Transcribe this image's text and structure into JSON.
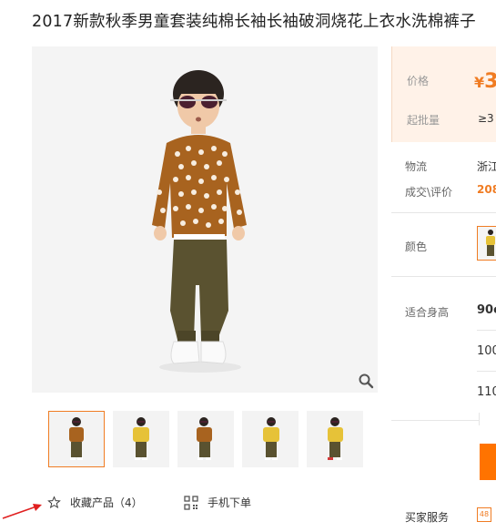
{
  "product": {
    "title": "2017新款秋季男童套装纯棉长袖长袖破洞烧花上衣水洗棉裤子"
  },
  "gallery": {
    "thumbnail_count": 5,
    "active_index": 0
  },
  "actions": {
    "favorite_label": "收藏产品（4）",
    "mobile_order_label": "手机下单"
  },
  "pricing": {
    "price_label": "价格",
    "price_currency": "¥",
    "price_value_partial": "3",
    "moq_label": "起批量",
    "moq_value_partial": "≥3"
  },
  "logistics": {
    "label": "物流",
    "value_partial": "浙江"
  },
  "transactions": {
    "label": "成交\\评价",
    "value_partial": "208"
  },
  "color": {
    "label": "颜色"
  },
  "size": {
    "label": "适合身高",
    "options": [
      "90c",
      "100",
      "110"
    ]
  },
  "service": {
    "label": "买家服务",
    "badge": "48"
  },
  "colors": {
    "accent": "#f07c23",
    "price_bg": "#fff2e8",
    "order_button": "#ff7300",
    "arrow": "#e02020"
  }
}
